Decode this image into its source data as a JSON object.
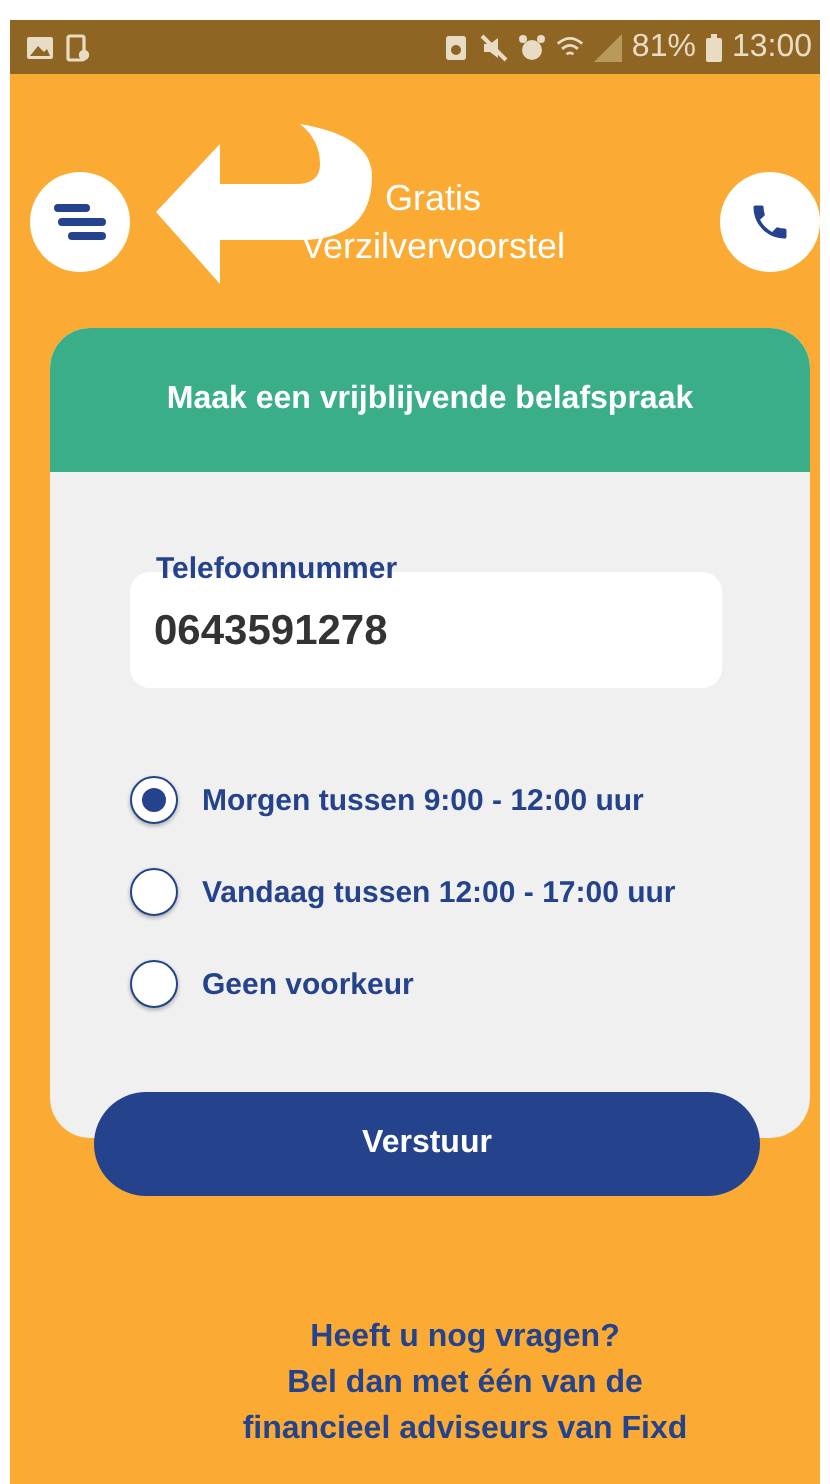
{
  "status_bar": {
    "battery": "81%",
    "time": "13:00"
  },
  "header": {
    "title_lines": [
      "Gratis",
      "Verzilvervoorstel"
    ]
  },
  "card": {
    "title": "Maak een vrijblijvende belafspraak",
    "phone_field": {
      "label": "Telefoonnummer",
      "value": "0643591278"
    },
    "options": [
      {
        "label": "Morgen tussen 9:00 - 12:00 uur",
        "selected": true
      },
      {
        "label": "Vandaag tussen 12:00 - 17:00 uur",
        "selected": false
      },
      {
        "label": "Geen voorkeur",
        "selected": false
      }
    ],
    "submit": "Verstuur"
  },
  "footer": [
    "Heeft u nog vragen?",
    "Bel dan met één van de",
    "financieel adviseurs van Fixd"
  ]
}
